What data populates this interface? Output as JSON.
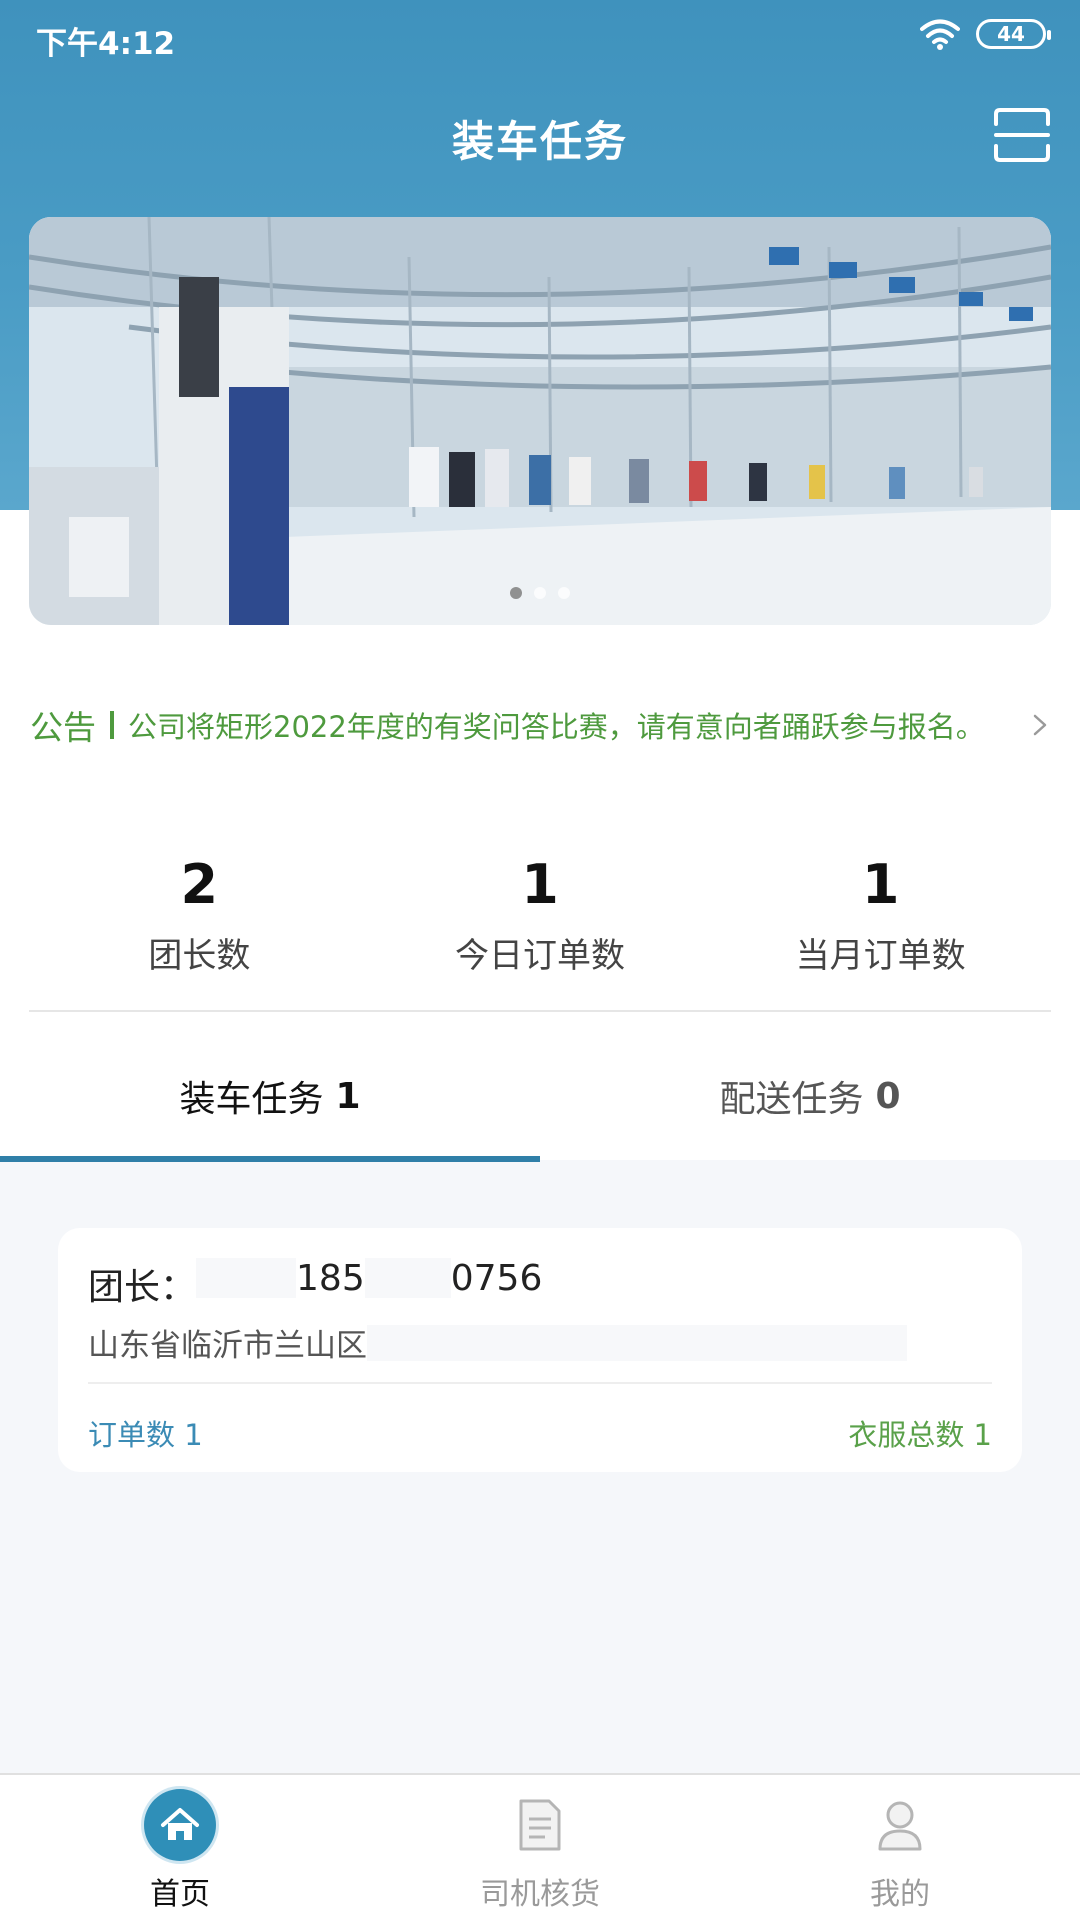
{
  "status_bar": {
    "time": "下午4:12",
    "battery": "44"
  },
  "header": {
    "title": "装车任务"
  },
  "banner": {
    "dots": 3,
    "active_dot": 0
  },
  "notice": {
    "label": "公告",
    "text": "公司将矩形2022年度的有奖问答比赛，请有意向者踊跃参与报名。"
  },
  "stats": [
    {
      "value": "2",
      "label": "团长数"
    },
    {
      "value": "1",
      "label": "今日订单数"
    },
    {
      "value": "1",
      "label": "当月订单数"
    }
  ],
  "tabs": [
    {
      "label": "装车任务",
      "count": "1",
      "active": true
    },
    {
      "label": "配送任务",
      "count": "0",
      "active": false
    }
  ],
  "card": {
    "leader_label": "团长：",
    "phone_prefix": "185",
    "phone_suffix": "0756",
    "address": "山东省临沂市兰山区",
    "orders": "订单数 1",
    "clothes": "衣服总数 1"
  },
  "nav": [
    {
      "label": "首页",
      "icon": "home-icon",
      "active": true
    },
    {
      "label": "司机核货",
      "icon": "document-icon",
      "active": false
    },
    {
      "label": "我的",
      "icon": "user-icon",
      "active": false
    }
  ],
  "colors": {
    "primary": "#2f8fb8",
    "notice": "#4e9a3e",
    "orders": "#3b8bb5",
    "clothes": "#5aa14a"
  }
}
